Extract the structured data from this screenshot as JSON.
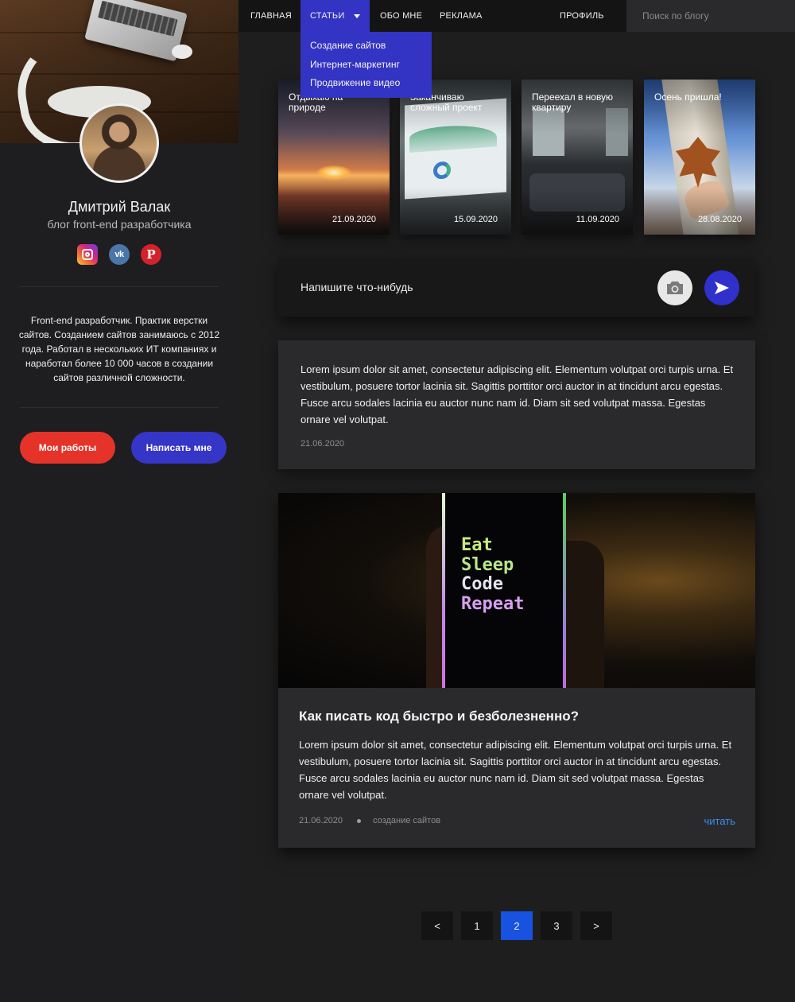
{
  "sidebar": {
    "name": "Дмитрий Валак",
    "tagline": "блог front-end разработчика",
    "socials": [
      {
        "icon": "instagram-icon"
      },
      {
        "icon": "vk-icon",
        "glyph": "vk"
      },
      {
        "icon": "pinterest-icon",
        "glyph": "P"
      }
    ],
    "about": "Front-end разработчик. Практик верстки сайтов.  Созданием сайтов занимаюсь с 2012 года. Работал в нескольких ИТ компаниях и наработал более 10 000 часов в создании сайтов различной сложности.",
    "buttons": {
      "works": "Мои работы",
      "contact": "Написать мне"
    },
    "colors": {
      "works": "#e5332a",
      "contact": "#3535c8"
    }
  },
  "nav": {
    "items": [
      "ГЛАВНАЯ",
      "СТАТЬИ",
      "ОБО МНЕ",
      "РЕКЛАМА",
      "ПРОФИЛЬ"
    ],
    "active_index": 1,
    "dropdown": [
      "Создание сайтов",
      "Интернет-маркетинг",
      "Продвижение видео"
    ],
    "search_placeholder": "Поиск по блогу",
    "accent": "#3333c4"
  },
  "stories": [
    {
      "title": "Отдыхаю на природе",
      "date": "21.09.2020"
    },
    {
      "title": "Заканчиваю сложный проект",
      "date": "15.09.2020"
    },
    {
      "title": "Переехал в новую квартиру",
      "date": "11.09.2020"
    },
    {
      "title": "Осень пришла!",
      "date": "28.08.2020"
    }
  ],
  "composer": {
    "placeholder": "Напишите что-нибудь",
    "camera_icon": "camera-icon",
    "send_icon": "send-icon"
  },
  "posts": [
    {
      "body": "Lorem ipsum dolor sit amet, consectetur adipiscing elit. Elementum volutpat orci turpis urna. Et vestibulum, posuere tortor lacinia sit. Sagittis porttitor orci auctor in at tincidunt arcu egestas. Fusce arcu sodales lacinia eu auctor nunc nam id. Diam sit sed volutpat massa. Egestas ornare vel volutpat.",
      "date": "21.06.2020"
    },
    {
      "image_text": [
        "Eat",
        "Sleep",
        "Code",
        "Repeat"
      ],
      "title": "Как писать код быстро и безболезненно?",
      "body": "Lorem ipsum dolor sit amet, consectetur adipiscing elit. Elementum volutpat orci turpis urna. Et vestibulum, posuere tortor lacinia sit. Sagittis porttitor orci auctor in at tincidunt arcu egestas. Fusce arcu sodales lacinia eu auctor nunc nam id. Diam sit sed volutpat massa. Egestas ornare vel volutpat.",
      "date": "21.06.2020",
      "category": "создание сайтов",
      "read_label": "читать"
    }
  ],
  "pagination": {
    "prev": "<",
    "pages": [
      "1",
      "2",
      "3"
    ],
    "current": "2",
    "next": ">",
    "accent": "#1752e0"
  }
}
